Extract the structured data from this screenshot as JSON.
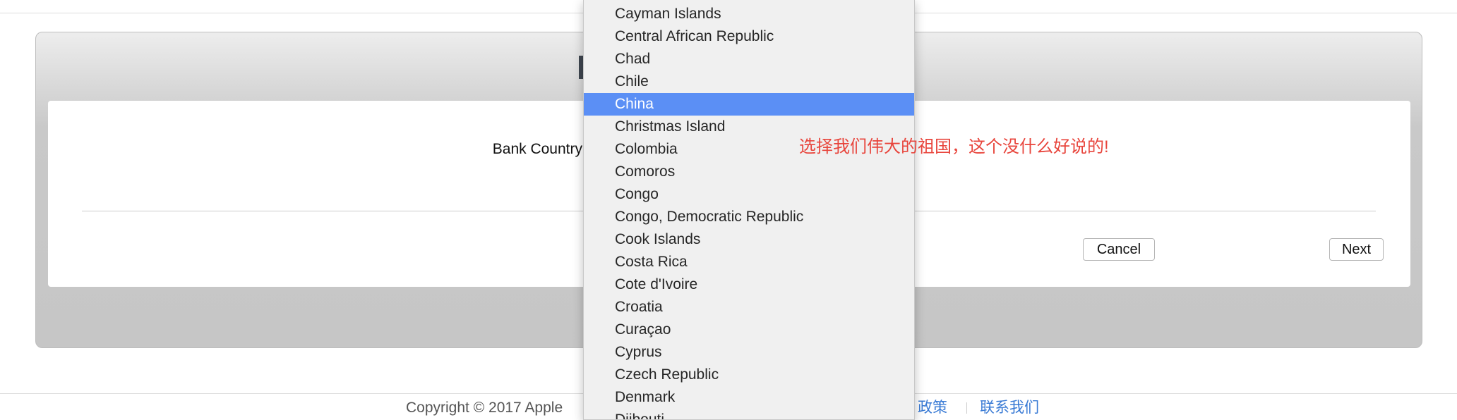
{
  "form": {
    "bank_country_label": "Bank Country",
    "cancel_label": "Cancel",
    "next_label": "Next"
  },
  "dropdown": {
    "selected": "China",
    "options": [
      "Cayman Islands",
      "Central African Republic",
      "Chad",
      "Chile",
      "China",
      "Christmas Island",
      "Colombia",
      "Comoros",
      "Congo",
      "Congo, Democratic Republic",
      "Cook Islands",
      "Costa Rica",
      "Cote d'Ivoire",
      "Croatia",
      "Curaçao",
      "Cyprus",
      "Czech Republic",
      "Denmark",
      "Djibouti"
    ]
  },
  "annotation": {
    "text": "选择我们伟大的祖国，这个没什么好说的!",
    "color": "#e8453c"
  },
  "footer": {
    "copyright": "Copyright © 2017 Apple",
    "policy_link": "政策",
    "contact_link": "联系我们"
  },
  "colors": {
    "highlight": "#5b8ff5"
  }
}
